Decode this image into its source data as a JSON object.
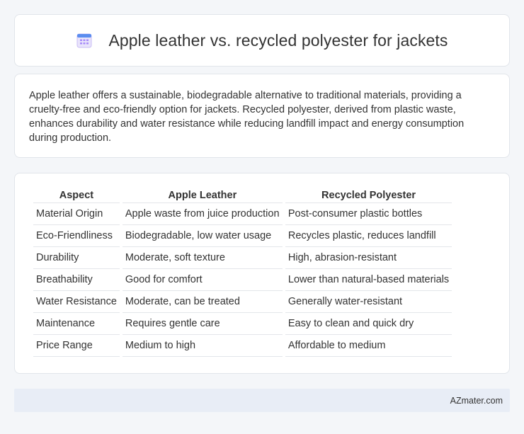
{
  "header": {
    "title": "Apple leather vs. recycled polyester for jackets",
    "icon": "calendar-icon"
  },
  "intro": {
    "text": "Apple leather offers a sustainable, biodegradable alternative to traditional materials, providing a cruelty-free and eco-friendly option for jackets. Recycled polyester, derived from plastic waste, enhances durability and water resistance while reducing landfill impact and energy consumption during production."
  },
  "table": {
    "headers": [
      "Aspect",
      "Apple Leather",
      "Recycled Polyester"
    ],
    "rows": [
      [
        "Material Origin",
        "Apple waste from juice production",
        "Post-consumer plastic bottles"
      ],
      [
        "Eco-Friendliness",
        "Biodegradable, low water usage",
        "Recycles plastic, reduces landfill"
      ],
      [
        "Durability",
        "Moderate, soft texture",
        "High, abrasion-resistant"
      ],
      [
        "Breathability",
        "Good for comfort",
        "Lower than natural-based materials"
      ],
      [
        "Water Resistance",
        "Moderate, can be treated",
        "Generally water-resistant"
      ],
      [
        "Maintenance",
        "Requires gentle care",
        "Easy to clean and quick dry"
      ],
      [
        "Price Range",
        "Medium to high",
        "Affordable to medium"
      ]
    ]
  },
  "footer": {
    "brand": "AZmater.com"
  },
  "colors": {
    "background": "#f4f6f9",
    "card": "#ffffff",
    "footer": "#e8edf6",
    "icon_blue": "#5b8def",
    "icon_purple": "#a78bfa"
  }
}
